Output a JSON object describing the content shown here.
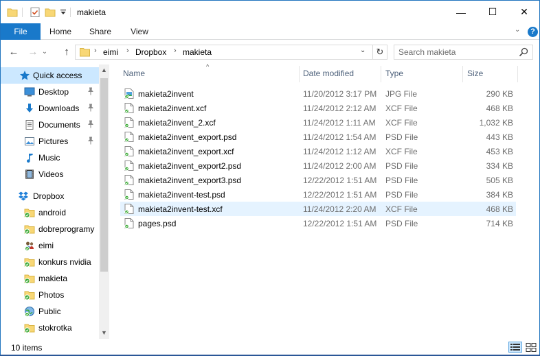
{
  "window": {
    "title": "makieta",
    "minimize": "—",
    "maximize": "☐",
    "close": "✕"
  },
  "ribbon": {
    "tabs": [
      "File",
      "Home",
      "Share",
      "View"
    ],
    "help": "?",
    "collapse": "⌄"
  },
  "nav": {
    "back": "←",
    "forward": "→",
    "recent": "⌄",
    "up": "↑"
  },
  "address": {
    "crumbs": [
      "eimi",
      "Dropbox",
      "makieta"
    ],
    "separator": "›",
    "dropdown": "⌄",
    "refresh": "↻"
  },
  "search": {
    "placeholder": "Search makieta"
  },
  "navpane": {
    "items": [
      {
        "label": "Quick access",
        "icon": "star-icon",
        "pinned": false
      },
      {
        "label": "Desktop",
        "icon": "desktop-icon",
        "pinned": true
      },
      {
        "label": "Downloads",
        "icon": "download-icon",
        "pinned": true
      },
      {
        "label": "Documents",
        "icon": "documents-icon",
        "pinned": true
      },
      {
        "label": "Pictures",
        "icon": "pictures-icon",
        "pinned": true
      },
      {
        "label": "Music",
        "icon": "music-icon",
        "pinned": false
      },
      {
        "label": "Videos",
        "icon": "videos-icon",
        "pinned": false
      },
      {
        "label": "Dropbox",
        "icon": "dropbox-icon",
        "pinned": false
      },
      {
        "label": "android",
        "icon": "folder-synced-icon",
        "pinned": false
      },
      {
        "label": "dobreprogramy",
        "icon": "folder-synced-icon",
        "pinned": false
      },
      {
        "label": "eimi",
        "icon": "shared-folder-icon",
        "pinned": false
      },
      {
        "label": "konkurs nvidia",
        "icon": "folder-synced-icon",
        "pinned": false
      },
      {
        "label": "makieta",
        "icon": "folder-synced-icon",
        "pinned": false
      },
      {
        "label": "Photos",
        "icon": "folder-synced-icon",
        "pinned": false
      },
      {
        "label": "Public",
        "icon": "public-folder-icon",
        "pinned": false
      },
      {
        "label": "stokrotka",
        "icon": "folder-synced-icon",
        "pinned": false
      }
    ],
    "scroll_up": "▲",
    "scroll_down": "▼"
  },
  "filelist": {
    "columns": {
      "name": "Name",
      "date": "Date modified",
      "type": "Type",
      "size": "Size"
    },
    "sort_indicator": "^",
    "rows": [
      {
        "name": "makieta2invent",
        "date": "11/20/2012 3:17 PM",
        "type": "JPG File",
        "size": "290 KB"
      },
      {
        "name": "makieta2invent.xcf",
        "date": "11/24/2012 2:12 AM",
        "type": "XCF File",
        "size": "468 KB"
      },
      {
        "name": "makieta2invent_2.xcf",
        "date": "11/24/2012 1:11 AM",
        "type": "XCF File",
        "size": "1,032 KB"
      },
      {
        "name": "makieta2invent_export.psd",
        "date": "11/24/2012 1:54 AM",
        "type": "PSD File",
        "size": "443 KB"
      },
      {
        "name": "makieta2invent_export.xcf",
        "date": "11/24/2012 1:12 AM",
        "type": "XCF File",
        "size": "453 KB"
      },
      {
        "name": "makieta2invent_export2.psd",
        "date": "11/24/2012 2:00 AM",
        "type": "PSD File",
        "size": "334 KB"
      },
      {
        "name": "makieta2invent_export3.psd",
        "date": "12/22/2012 1:51 AM",
        "type": "PSD File",
        "size": "505 KB"
      },
      {
        "name": "makieta2invent-test.psd",
        "date": "12/22/2012 1:51 AM",
        "type": "PSD File",
        "size": "384 KB"
      },
      {
        "name": "makieta2invent-test.xcf",
        "date": "11/24/2012 2:20 AM",
        "type": "XCF File",
        "size": "468 KB"
      },
      {
        "name": "pages.psd",
        "date": "12/22/2012 1:51 AM",
        "type": "PSD File",
        "size": "714 KB"
      }
    ]
  },
  "status": {
    "item_count": "10 items"
  },
  "colors": {
    "accent": "#1979ca",
    "selection": "#cce8ff",
    "hover": "#e5f3ff",
    "folder": "#f8d775",
    "sync_green": "#3aaa35"
  }
}
